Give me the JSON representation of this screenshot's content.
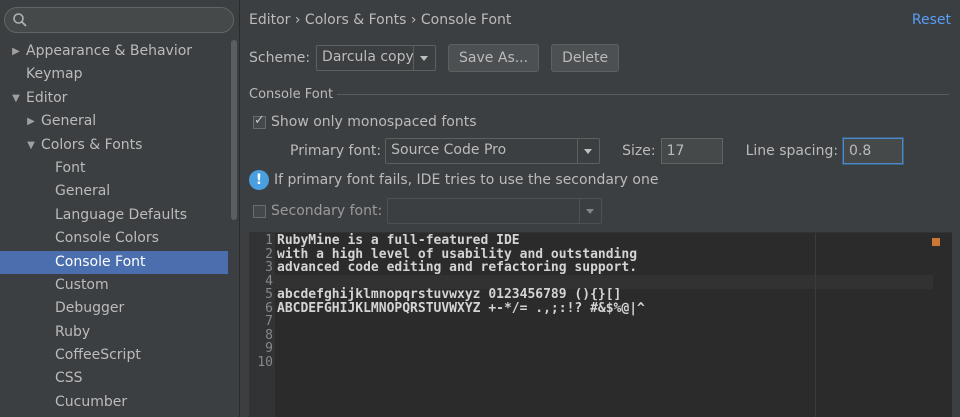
{
  "search": {
    "value": "",
    "placeholder": ""
  },
  "sidebar": {
    "items": [
      {
        "label": "Appearance & Behavior",
        "arrow": "▶",
        "indent": 0
      },
      {
        "label": "Keymap",
        "arrow": "",
        "indent": 0
      },
      {
        "label": "Editor",
        "arrow": "▼",
        "indent": 0
      },
      {
        "label": "General",
        "arrow": "▶",
        "indent": 1
      },
      {
        "label": "Colors & Fonts",
        "arrow": "▼",
        "indent": 1
      },
      {
        "label": "Font",
        "arrow": "",
        "indent": 2
      },
      {
        "label": "General",
        "arrow": "",
        "indent": 2
      },
      {
        "label": "Language Defaults",
        "arrow": "",
        "indent": 2
      },
      {
        "label": "Console Colors",
        "arrow": "",
        "indent": 2
      },
      {
        "label": "Console Font",
        "arrow": "",
        "indent": 2,
        "selected": true
      },
      {
        "label": "Custom",
        "arrow": "",
        "indent": 2
      },
      {
        "label": "Debugger",
        "arrow": "",
        "indent": 2
      },
      {
        "label": "Ruby",
        "arrow": "",
        "indent": 2
      },
      {
        "label": "CoffeeScript",
        "arrow": "",
        "indent": 2
      },
      {
        "label": "CSS",
        "arrow": "",
        "indent": 2
      },
      {
        "label": "Cucumber",
        "arrow": "",
        "indent": 2
      }
    ]
  },
  "header": {
    "breadcrumb": "Editor › Colors & Fonts › Console Font",
    "reset_label": "Reset"
  },
  "scheme": {
    "label": "Scheme:",
    "value": "Darcula copy",
    "save_as_label": "Save As...",
    "delete_label": "Delete"
  },
  "console_font": {
    "section_title": "Console Font",
    "monospaced_label": "Show only monospaced fonts",
    "monospaced_checked": true,
    "primary_label": "Primary font:",
    "primary_value": "Source Code Pro",
    "size_label": "Size:",
    "size_value": "17",
    "line_spacing_label": "Line spacing:",
    "line_spacing_value": "0.8",
    "info_text": "If primary font fails, IDE tries to use the secondary one",
    "secondary_label": "Secondary font:",
    "secondary_checked": false,
    "secondary_value": ""
  },
  "preview": {
    "line_numbers": [
      "1",
      "2",
      "3",
      "4",
      "5",
      "6",
      "7",
      "8",
      "9",
      "10"
    ],
    "lines": [
      "RubyMine is a full-featured IDE",
      "with a high level of usability and outstanding",
      "advanced code editing and refactoring support.",
      "",
      "abcdefghijklmnopqrstuvwxyz 0123456789 (){}[]",
      "ABCDEFGHIJKLMNOPQRSTUVWXYZ +-*/= .,;:!? #&$%@|^",
      "",
      "",
      "",
      ""
    ]
  },
  "colors": {
    "accent": "#4b6eaf",
    "link": "#589df6",
    "background": "#3c3f41",
    "editor_background": "#2b2b2b"
  }
}
